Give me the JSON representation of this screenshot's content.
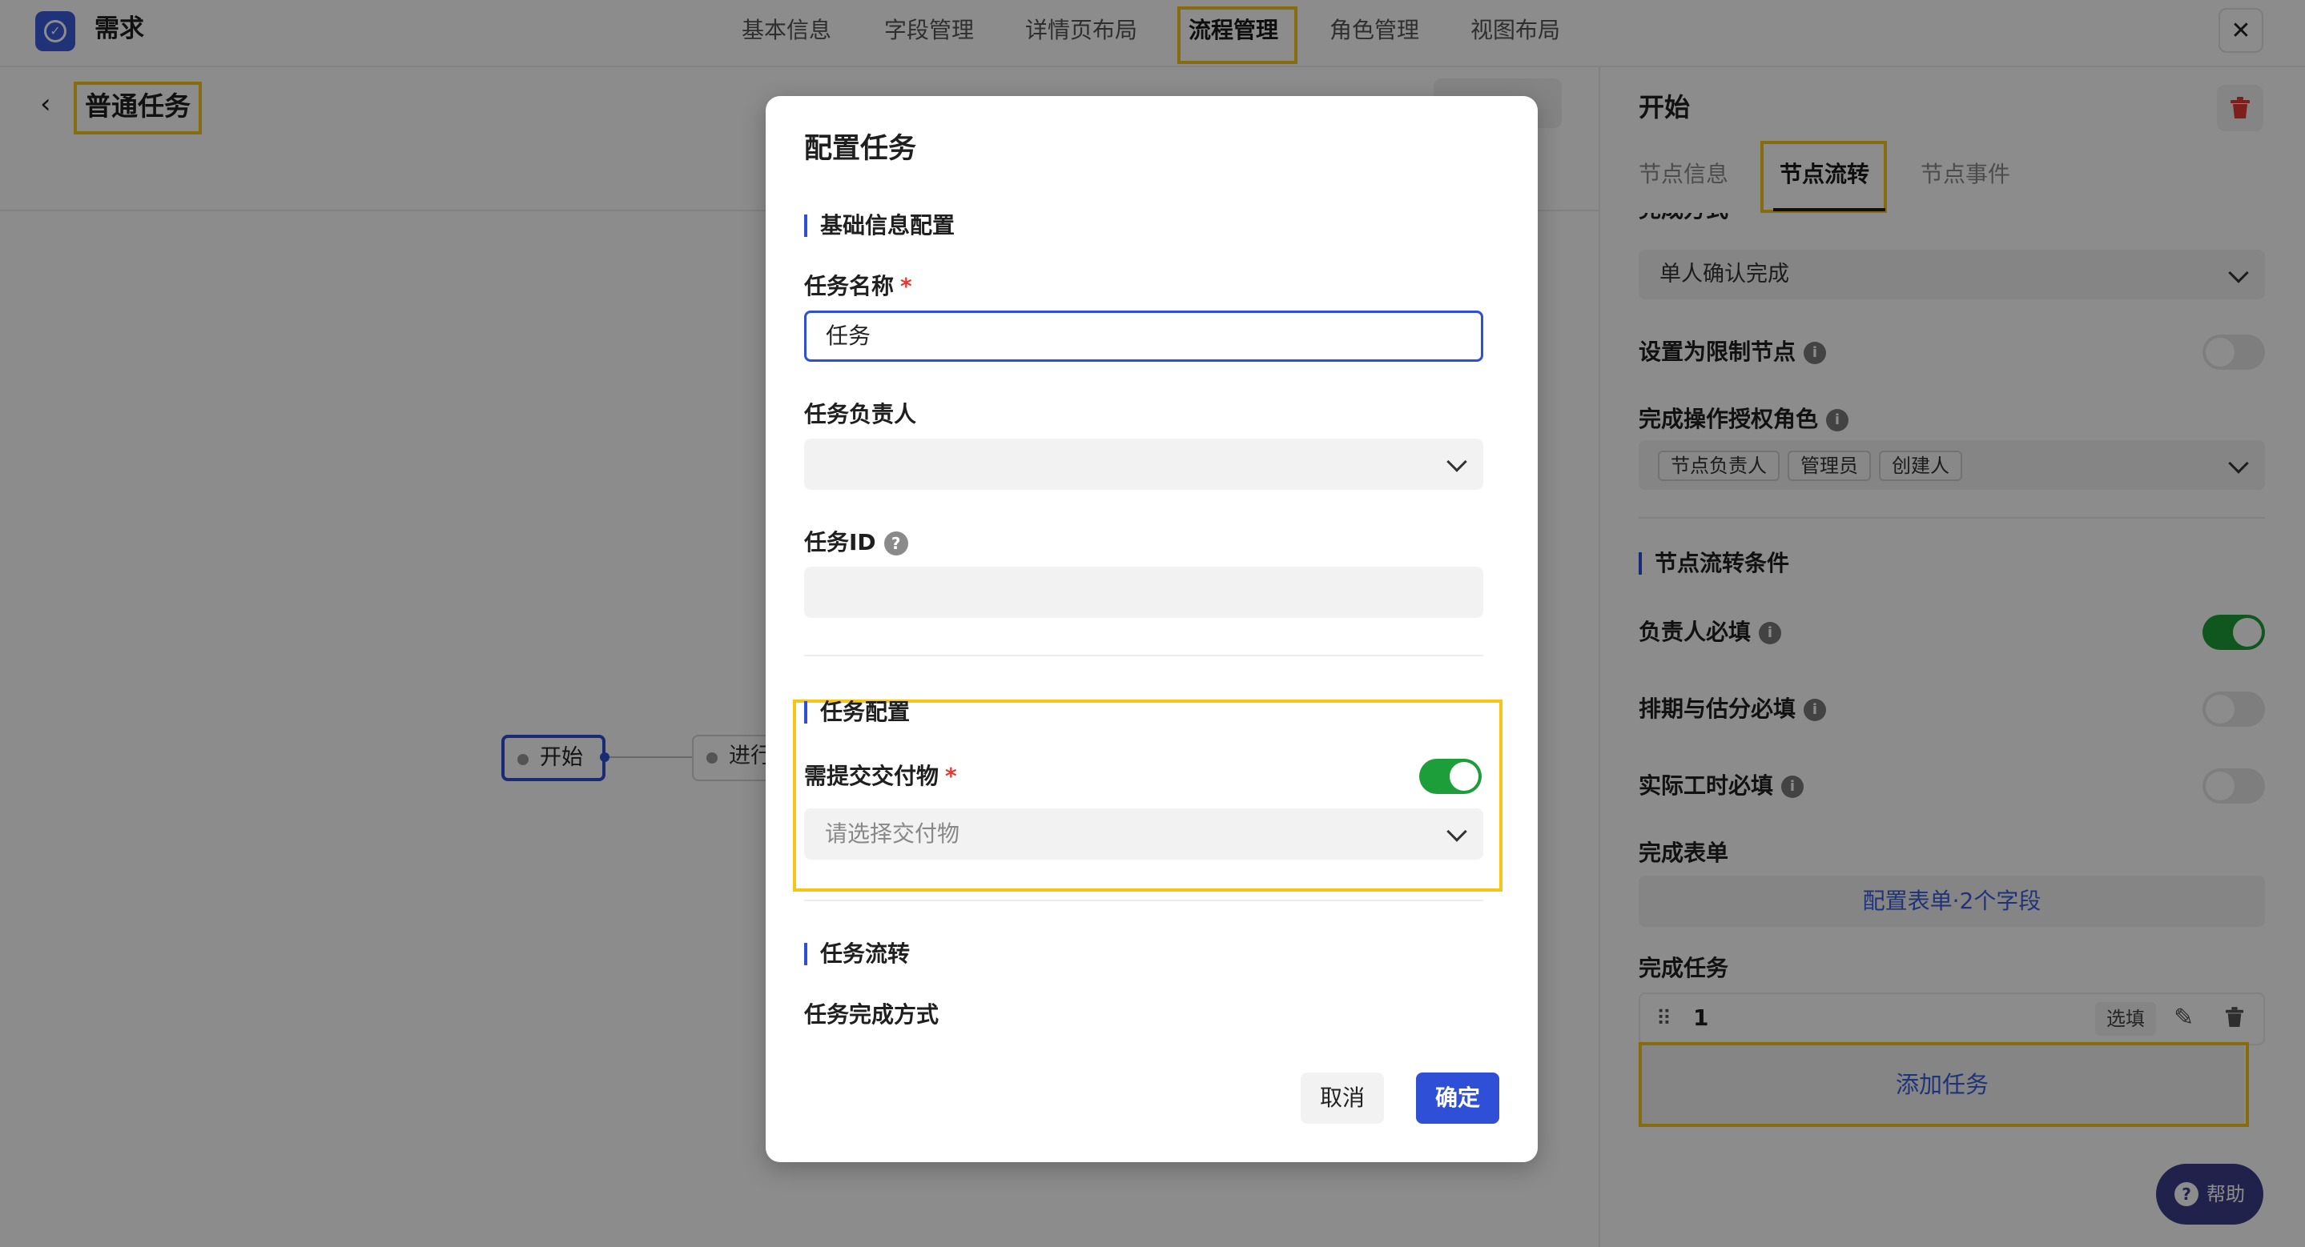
{
  "header": {
    "app_title": "需求",
    "tabs": [
      "基本信息",
      "字段管理",
      "详情页布局",
      "流程管理",
      "角色管理",
      "视图布局"
    ],
    "close_glyph": "✕"
  },
  "subheader": {
    "back_glyph": "‹",
    "title": "普通任务"
  },
  "canvas": {
    "nodes": [
      "开始",
      "进行"
    ]
  },
  "right_panel": {
    "title": "开始",
    "tabs": [
      "节点信息",
      "节点流转",
      "节点事件"
    ],
    "completion_method_label": "完成方式",
    "completion_method_value": "单人确认完成",
    "restrict_node_label": "设置为限制节点",
    "auth_roles_label": "完成操作授权角色",
    "auth_roles": [
      "节点负责人",
      "管理员",
      "创建人"
    ],
    "conditions_title": "节点流转条件",
    "conditions": [
      {
        "label": "负责人必填",
        "on": true
      },
      {
        "label": "排期与估分必填",
        "on": false
      },
      {
        "label": "实际工时必填",
        "on": false
      }
    ],
    "form_label": "完成表单",
    "form_button": "配置表单·2个字段",
    "tasks_label": "完成任务",
    "task_item": {
      "name": "1",
      "tag": "选填"
    },
    "add_task": "添加任务",
    "help": "帮助"
  },
  "modal": {
    "title": "配置任务",
    "basic_section": "基础信息配置",
    "task_name_label": "任务名称",
    "task_name_value": "任务",
    "owner_label": "任务负责人",
    "task_id_label": "任务ID",
    "task_config_section": "任务配置",
    "deliverable_label": "需提交交付物",
    "deliverable_on": true,
    "deliverable_placeholder": "请选择交付物",
    "flow_section": "任务流转",
    "completion_method_label": "任务完成方式",
    "cancel": "取消",
    "ok": "确定",
    "required_mark": "*"
  },
  "colors": {
    "primary": "#2f4fd6",
    "toggle_on": "#1e9e3a",
    "highlight": "#f5c518"
  }
}
